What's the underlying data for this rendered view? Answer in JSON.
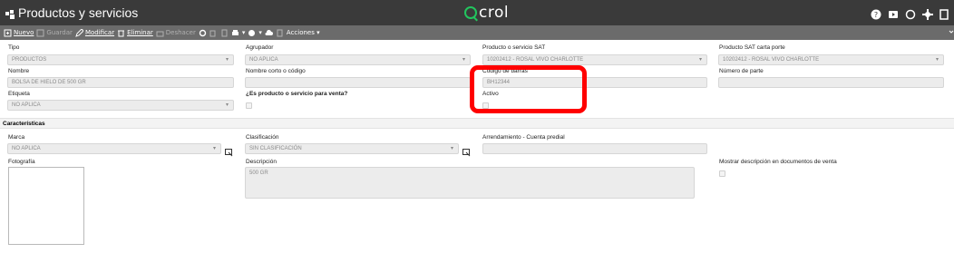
{
  "app": {
    "title": "Productos y servicios",
    "logo_text": "crol"
  },
  "toolbar": {
    "nuevo": "Nuevo",
    "guardar": "Guardar",
    "modificar": "Modificar",
    "eliminar": "Eliminar",
    "deshacer": "Deshacer",
    "acciones": "Acciones ▾"
  },
  "fields": {
    "tipo": {
      "label": "Tipo",
      "value": "PRODUCTOS"
    },
    "agrupador": {
      "label": "Agrupador",
      "value": "NO APLICA"
    },
    "producto_sat": {
      "label": "Producto o servicio SAT",
      "value": "10202412 - ROSAL VIVO CHARLOTTE"
    },
    "producto_sat_carta": {
      "label": "Producto SAT carta porte",
      "value": "10202412 - ROSAL VIVO CHARLOTTE"
    },
    "nombre": {
      "label": "Nombre",
      "value": "BOLSA DE HIELO DE 500 GR"
    },
    "nombre_corto": {
      "label": "Nombre corto o código",
      "value": ""
    },
    "codigo_barras": {
      "label": "Código de barras",
      "value": "BH12344"
    },
    "numero_parte": {
      "label": "Número de parte",
      "value": ""
    },
    "etiqueta": {
      "label": "Etiqueta",
      "value": "NO APLICA"
    },
    "es_venta": {
      "label": "¿Es producto o servicio para venta?"
    },
    "activo": {
      "label": "Activo"
    }
  },
  "caracteristicas": {
    "title": "Características",
    "marca": {
      "label": "Marca",
      "value": "NO APLICA"
    },
    "clasificacion": {
      "label": "Clasificación",
      "value": "SIN CLASIFICACIÓN"
    },
    "arrendamiento": {
      "label": "Arrendamiento - Cuenta predial",
      "value": ""
    },
    "fotografia": {
      "label": "Fotografía"
    },
    "descripcion": {
      "label": "Descripción",
      "value": "500 GR"
    },
    "mostrar_desc": {
      "label": "Mostrar descripción en documentos de venta"
    }
  },
  "colors": {
    "titlebar": "#3a3a3a",
    "toolbar": "#6b6b6b",
    "accent": "#22c55e",
    "highlight": "#ff0000"
  }
}
